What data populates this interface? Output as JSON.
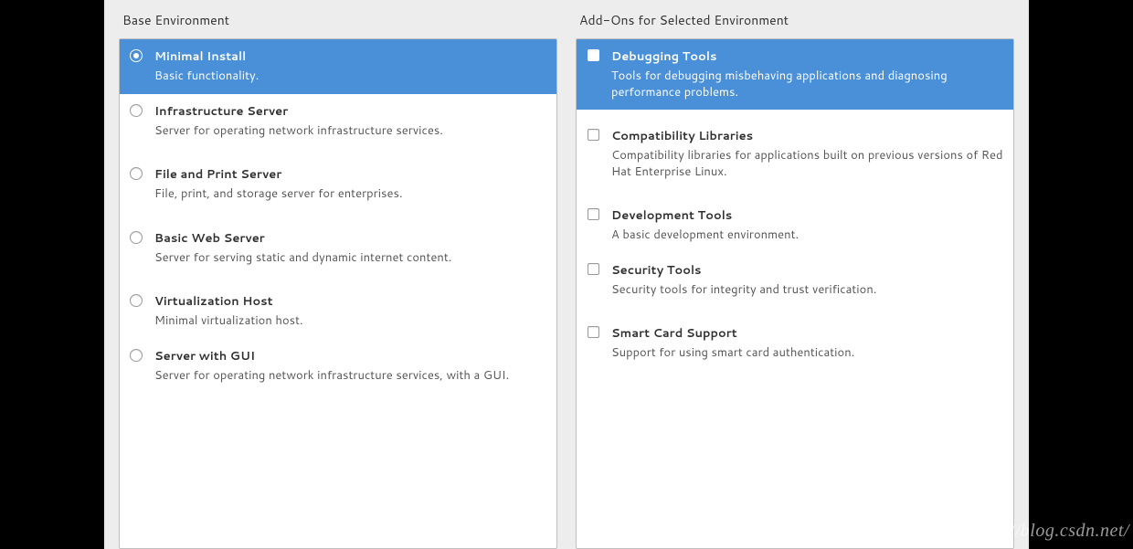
{
  "leftTitle": "Base Environment",
  "rightTitle": "Add-Ons for Selected Environment",
  "watermark": "http://blog.csdn.net/",
  "environments": [
    {
      "title": "Minimal Install",
      "desc": "Basic functionality.",
      "selected": true
    },
    {
      "title": "Infrastructure Server",
      "desc": "Server for operating network infrastructure services.",
      "selected": false
    },
    {
      "title": "File and Print Server",
      "desc": "File, print, and storage server for enterprises.",
      "selected": false
    },
    {
      "title": "Basic Web Server",
      "desc": "Server for serving static and dynamic internet content.",
      "selected": false
    },
    {
      "title": "Virtualization Host",
      "desc": "Minimal virtualization host.",
      "selected": false
    },
    {
      "title": "Server with GUI",
      "desc": "Server for operating network infrastructure services, with a GUI.",
      "selected": false
    }
  ],
  "addons": [
    {
      "title": "Debugging Tools",
      "desc": "Tools for debugging misbehaving applications and diagnosing performance problems.",
      "highlighted": true
    },
    {
      "title": "Compatibility Libraries",
      "desc": "Compatibility libraries for applications built on previous versions of Red Hat Enterprise Linux.",
      "highlighted": false
    },
    {
      "title": "Development Tools",
      "desc": "A basic development environment.",
      "highlighted": false
    },
    {
      "title": "Security Tools",
      "desc": "Security tools for integrity and trust verification.",
      "highlighted": false
    },
    {
      "title": "Smart Card Support",
      "desc": "Support for using smart card authentication.",
      "highlighted": false
    }
  ]
}
